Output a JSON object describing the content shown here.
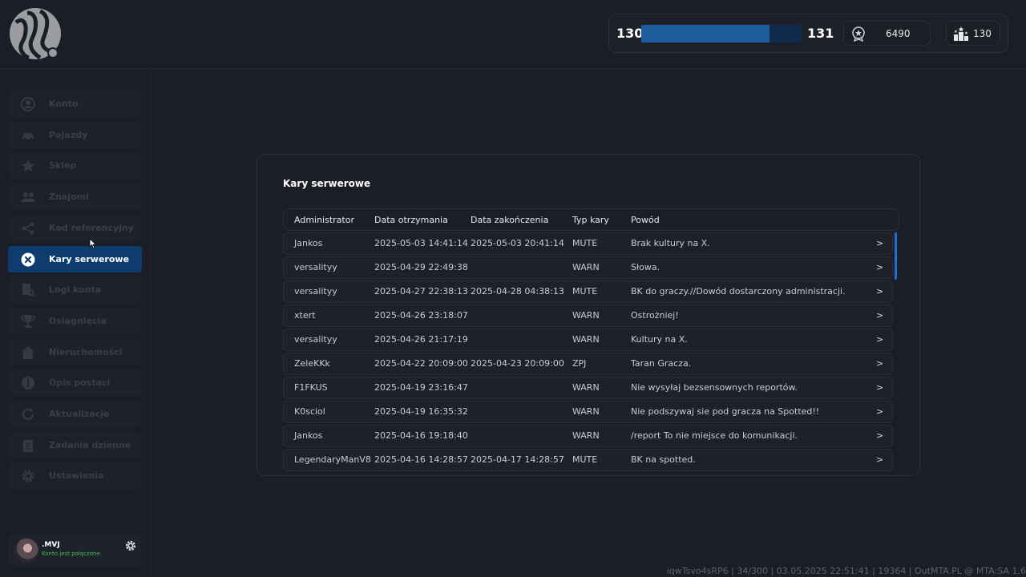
{
  "header": {
    "level_current": "130",
    "level_next": "131",
    "xp_progress_fraction": 0.8,
    "points_value": "6490",
    "points_icon": "medal-icon",
    "rank_value": "130",
    "rank_icon": "podium-icon"
  },
  "sidebar": {
    "items": [
      {
        "label": "Konto",
        "icon": "user-circle-icon"
      },
      {
        "label": "Pojazdy",
        "icon": "car-icon"
      },
      {
        "label": "Sklep",
        "icon": "star-icon"
      },
      {
        "label": "Znajomi",
        "icon": "friends-icon"
      },
      {
        "label": "Kod referencyjny",
        "icon": "share-icon"
      },
      {
        "label": "Kary serwerowe",
        "icon": "close-circle-icon"
      },
      {
        "label": "Logi konta",
        "icon": "log-search-icon"
      },
      {
        "label": "Osiągnięcia",
        "icon": "trophy-icon"
      },
      {
        "label": "Nieruchomości",
        "icon": "house-icon"
      },
      {
        "label": "Opis postaci",
        "icon": "info-icon"
      },
      {
        "label": "Aktualizacje",
        "icon": "refresh-icon"
      },
      {
        "label": "Zadania dzienne",
        "icon": "clipboard-icon"
      },
      {
        "label": "Ustawienia",
        "icon": "gear-icon"
      }
    ],
    "active_index": 5,
    "user": {
      "name": ".MVJ",
      "status": "Konto jest połączone."
    }
  },
  "panel": {
    "title": "Kary serwerowe",
    "columns": [
      "Administrator",
      "Data otrzymania",
      "Data zakończenia",
      "Typ kary",
      "Powód"
    ],
    "rows": [
      {
        "admin": "Jankos",
        "received": "2025-05-03 14:41:14",
        "ends": "2025-05-03 20:41:14",
        "type": "MUTE",
        "reason": "Brak kultury na X."
      },
      {
        "admin": "versalityy",
        "received": "2025-04-29 22:49:38",
        "ends": "",
        "type": "WARN",
        "reason": "Słowa."
      },
      {
        "admin": "versalityy",
        "received": "2025-04-27 22:38:13",
        "ends": "2025-04-28 04:38:13",
        "type": "MUTE",
        "reason": "BK do graczy.//Dowód dostarczony administracji."
      },
      {
        "admin": "xtert",
        "received": "2025-04-26 23:18:07",
        "ends": "",
        "type": "WARN",
        "reason": "Ostrożniej!"
      },
      {
        "admin": "versalityy",
        "received": "2025-04-26 21:17:19",
        "ends": "",
        "type": "WARN",
        "reason": "Kultury na X."
      },
      {
        "admin": "ZeleKKk",
        "received": "2025-04-22 20:09:00",
        "ends": "2025-04-23 20:09:00",
        "type": "ZPJ",
        "reason": "Taran Gracza."
      },
      {
        "admin": "F1FKUS",
        "received": "2025-04-19 23:16:47",
        "ends": "",
        "type": "WARN",
        "reason": "Nie wysyłaj bezsensownych reportów."
      },
      {
        "admin": "K0sciol",
        "received": "2025-04-19 16:35:32",
        "ends": "",
        "type": "WARN",
        "reason": "Nie podszywaj sie pod gracza na Spotted!!"
      },
      {
        "admin": "Jankos",
        "received": "2025-04-16 19:18:40",
        "ends": "",
        "type": "WARN",
        "reason": "/report To nie miejsce do komunikacji."
      },
      {
        "admin": "LegendaryManV8",
        "received": "2025-04-16 14:28:57",
        "ends": "2025-04-17 14:28:57",
        "type": "MUTE",
        "reason": "BK na spotted."
      }
    ],
    "row_arrow": ">"
  },
  "footer": {
    "text": "iqwTsvo4sRP6 | 34/300 | 03.05.2025 22:51:41 | 19364 | OutMTA.PL @ MTA:SA 1.6"
  },
  "colors": {
    "accent": "#0e3c6e",
    "xp_fill": "#1f5c9e",
    "scrollbar": "#1c6fd6",
    "status_online": "#3fc14f"
  }
}
